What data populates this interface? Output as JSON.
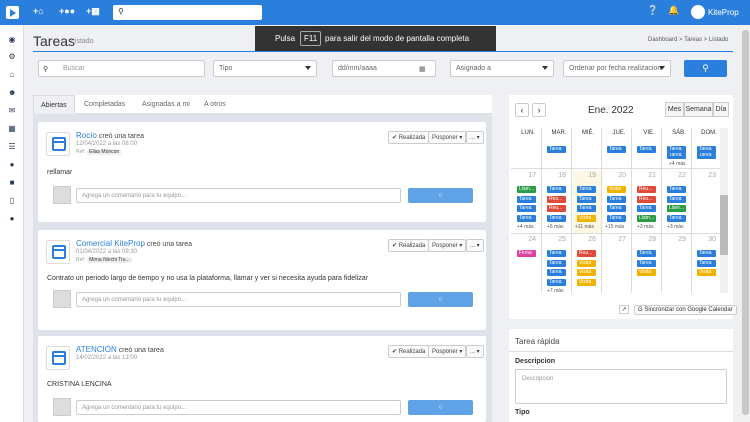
{
  "topbar": {
    "add1": "+",
    "add2": "+",
    "add3": "+",
    "user": "KiteProp"
  },
  "page": {
    "title": "Tareas",
    "subtitle": "Listado"
  },
  "banner": {
    "pre": "Pulsa",
    "key": "F11",
    "post": "para salir del modo de pantalla completa"
  },
  "breadcrumb": "Dashboard  >  Tareas  >  Listado",
  "filters": {
    "search_placeholder": "Buscar",
    "type": "Tipo",
    "date": "dd/mm/aaaa",
    "assigned": "Asignado a",
    "order": "Ordenar por fecha realizacion"
  },
  "tabs": [
    "Abiertas",
    "Completadas",
    "Asignadas a mi",
    "A otros"
  ],
  "tasks": [
    {
      "author": "Rocío",
      "action": "creó una tarea",
      "date": "12/04/2022 a las 08:00",
      "ref": "Ref:",
      "chip": "Elias Moncon",
      "body": "rellamar",
      "comment": "Agrega un comentario para tu equipo...",
      "realizada": "Realizada",
      "posponer": "Posponer"
    },
    {
      "author": "Comercial KiteProp",
      "action": "creó una tarea",
      "date": "01/04/2022 a las 09:30",
      "ref": "Ref:",
      "chip": "Mirna Niochi Tru...",
      "body": "Contrato un periodo largo de tiempo y no usa la plataforma, llamar y ver si necesita ayuda para fidelizar",
      "comment": "Agrega un comentario para tu equipo...",
      "realizada": "Realizada",
      "posponer": "Posponer"
    },
    {
      "author": "ATENCIÓN",
      "action": "creó una tarea",
      "date": "14/02/2022 a las 13:00",
      "ref": "",
      "chip": "",
      "body": "CRISTINA LENCINA",
      "comment": "Agrega un comentario para tu equipo...",
      "realizada": "Realizada",
      "posponer": "Posponer"
    }
  ],
  "calendar": {
    "month": "Ene. 2022",
    "views": [
      "Mes",
      "Semana",
      "Día"
    ],
    "dow": [
      "LUN.",
      "MAR.",
      "MIÉ.",
      "JUE.",
      "VIE.",
      "SÁB.",
      "DOM."
    ],
    "row2": [
      "17",
      "18",
      "19",
      "20",
      "21",
      "22",
      "23"
    ],
    "row3": [
      "24",
      "25",
      "26",
      "27",
      "28",
      "29",
      "30"
    ],
    "more": {
      "r1_sat": "+4 más",
      "r2_mon": "+4 más",
      "r2_tue": "+5 más",
      "r2_wed": "+11 más",
      "r2_thu": "+15 más",
      "r2_fri": "+3 más",
      "r2_sat": "+3 más",
      "r3_tue": "+7 más"
    },
    "event_labels": {
      "tarea": "Tarea",
      "reunion": "Reu...",
      "visita": "Visita",
      "llamada": "Llam...",
      "firma": "Firma"
    },
    "sync": "Sincronizar con Google Calendar"
  },
  "quick": {
    "title": "Tarea rápida",
    "desc_label": "Descripcion",
    "desc_placeholder": "Descripcion",
    "type_label": "Tipo"
  },
  "colors": {
    "tarea": "#2b7fdc",
    "reunion": "#e04a3b",
    "visita": "#f0b400",
    "llamada": "#2a9d45",
    "firma": "#e040a0"
  },
  "icons": [
    "home-icon",
    "gear-icon",
    "house-icon",
    "users-icon",
    "mail-icon",
    "calendar-icon",
    "list-icon",
    "globe-icon",
    "cart-icon",
    "file-icon",
    "person-icon"
  ]
}
